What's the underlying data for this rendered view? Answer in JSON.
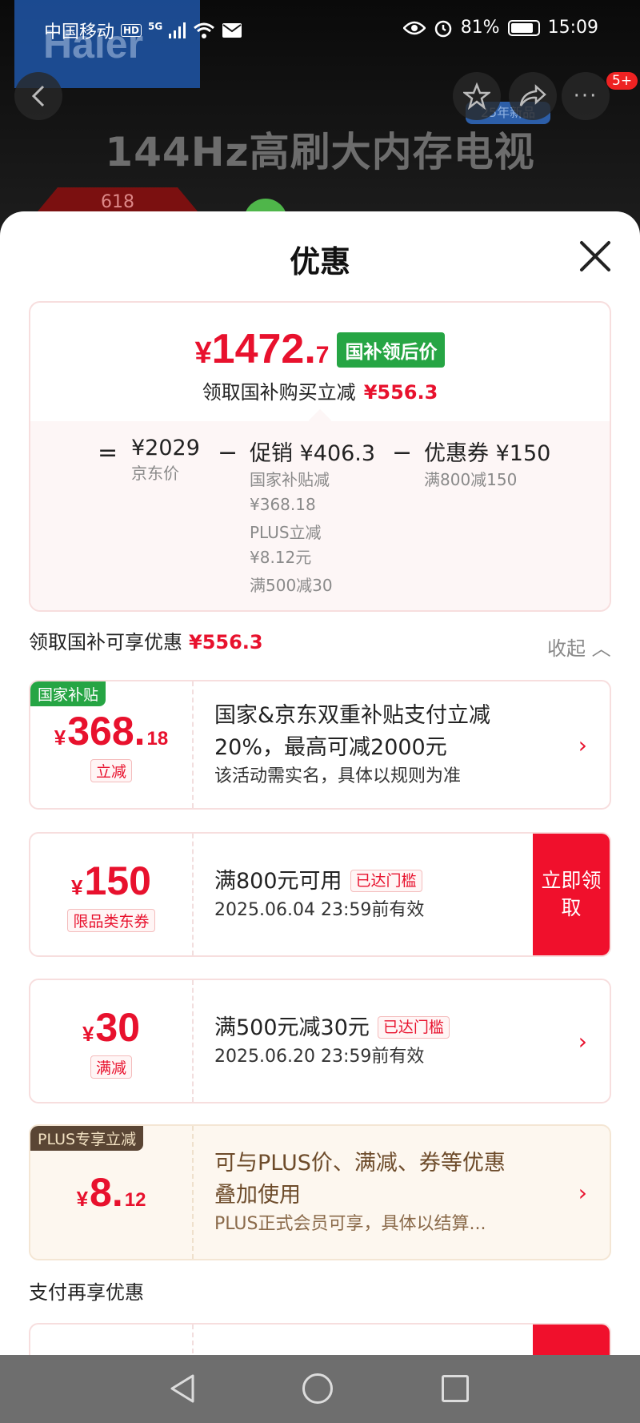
{
  "status_bar": {
    "carrier": "中国移动",
    "hd": "HD",
    "net": "5G",
    "battery": "81%",
    "time": "15:09"
  },
  "background": {
    "brand": "Haier",
    "title": "144Hz高刷大内存电视",
    "badge": "25年新品",
    "tag_618": "618",
    "more_badge": "5+"
  },
  "sheet": {
    "title": "优惠",
    "final_price": {
      "currency": "¥",
      "integer": "1472.",
      "decimal": "7",
      "tag": "国补领后价"
    },
    "reduce_label": "领取国补购买立减",
    "reduce_amount": "¥556.3",
    "formula": {
      "eq": "=",
      "minus": "−",
      "base": {
        "value": "¥2029",
        "label": "京东价"
      },
      "promo": {
        "title": "促销 ¥406.3",
        "items": [
          "国家补贴减",
          "¥368.18",
          "PLUS立减",
          "¥8.12元",
          "满500减30"
        ]
      },
      "coupon": {
        "title": "优惠券 ¥150",
        "items": [
          "满800减150"
        ]
      }
    },
    "enjoy_label": "领取国补可享优惠",
    "enjoy_amount": "¥556.3",
    "collapse_label": "收起 ︿",
    "cards": [
      {
        "corner": "国家补贴",
        "currency": "¥",
        "integer": "368.",
        "decimal": "18",
        "tag": "立减",
        "line1a": "国家&京东双重补贴支付立减",
        "line1b": "20%，最高可减2000元",
        "line2": "该活动需实名，具体以规则为准",
        "chev": "›"
      },
      {
        "currency": "¥",
        "integer": "150",
        "tag": "限品类东券",
        "line1": "满800元可用",
        "met": "已达门槛",
        "line2": "2025.06.04 23:59前有效",
        "button": "立即领取"
      },
      {
        "currency": "¥",
        "integer": "30",
        "tag": "满减",
        "line1": "满500元减30元",
        "met": "已达门槛",
        "line2": "2025.06.20 23:59前有效",
        "chev": "›"
      },
      {
        "corner": "PLUS专享立减",
        "currency": "¥",
        "integer": "8.",
        "decimal": "12",
        "line1a": "可与PLUS价、满减、券等优惠",
        "line1b": "叠加使用",
        "line2": "PLUS正式会员可享，具体以结算...",
        "chev": "›"
      }
    ],
    "pay_label": "支付再享优惠"
  }
}
